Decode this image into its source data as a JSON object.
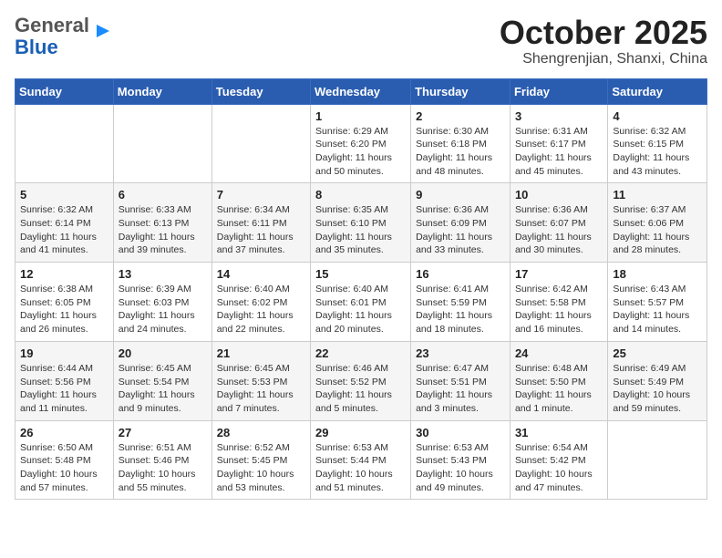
{
  "header": {
    "logo_general": "General",
    "logo_blue": "Blue",
    "month_title": "October 2025",
    "location": "Shengrenjian, Shanxi, China"
  },
  "weekdays": [
    "Sunday",
    "Monday",
    "Tuesday",
    "Wednesday",
    "Thursday",
    "Friday",
    "Saturday"
  ],
  "weeks": [
    [
      {
        "day": "",
        "info": ""
      },
      {
        "day": "",
        "info": ""
      },
      {
        "day": "",
        "info": ""
      },
      {
        "day": "1",
        "info": "Sunrise: 6:29 AM\nSunset: 6:20 PM\nDaylight: 11 hours\nand 50 minutes."
      },
      {
        "day": "2",
        "info": "Sunrise: 6:30 AM\nSunset: 6:18 PM\nDaylight: 11 hours\nand 48 minutes."
      },
      {
        "day": "3",
        "info": "Sunrise: 6:31 AM\nSunset: 6:17 PM\nDaylight: 11 hours\nand 45 minutes."
      },
      {
        "day": "4",
        "info": "Sunrise: 6:32 AM\nSunset: 6:15 PM\nDaylight: 11 hours\nand 43 minutes."
      }
    ],
    [
      {
        "day": "5",
        "info": "Sunrise: 6:32 AM\nSunset: 6:14 PM\nDaylight: 11 hours\nand 41 minutes."
      },
      {
        "day": "6",
        "info": "Sunrise: 6:33 AM\nSunset: 6:13 PM\nDaylight: 11 hours\nand 39 minutes."
      },
      {
        "day": "7",
        "info": "Sunrise: 6:34 AM\nSunset: 6:11 PM\nDaylight: 11 hours\nand 37 minutes."
      },
      {
        "day": "8",
        "info": "Sunrise: 6:35 AM\nSunset: 6:10 PM\nDaylight: 11 hours\nand 35 minutes."
      },
      {
        "day": "9",
        "info": "Sunrise: 6:36 AM\nSunset: 6:09 PM\nDaylight: 11 hours\nand 33 minutes."
      },
      {
        "day": "10",
        "info": "Sunrise: 6:36 AM\nSunset: 6:07 PM\nDaylight: 11 hours\nand 30 minutes."
      },
      {
        "day": "11",
        "info": "Sunrise: 6:37 AM\nSunset: 6:06 PM\nDaylight: 11 hours\nand 28 minutes."
      }
    ],
    [
      {
        "day": "12",
        "info": "Sunrise: 6:38 AM\nSunset: 6:05 PM\nDaylight: 11 hours\nand 26 minutes."
      },
      {
        "day": "13",
        "info": "Sunrise: 6:39 AM\nSunset: 6:03 PM\nDaylight: 11 hours\nand 24 minutes."
      },
      {
        "day": "14",
        "info": "Sunrise: 6:40 AM\nSunset: 6:02 PM\nDaylight: 11 hours\nand 22 minutes."
      },
      {
        "day": "15",
        "info": "Sunrise: 6:40 AM\nSunset: 6:01 PM\nDaylight: 11 hours\nand 20 minutes."
      },
      {
        "day": "16",
        "info": "Sunrise: 6:41 AM\nSunset: 5:59 PM\nDaylight: 11 hours\nand 18 minutes."
      },
      {
        "day": "17",
        "info": "Sunrise: 6:42 AM\nSunset: 5:58 PM\nDaylight: 11 hours\nand 16 minutes."
      },
      {
        "day": "18",
        "info": "Sunrise: 6:43 AM\nSunset: 5:57 PM\nDaylight: 11 hours\nand 14 minutes."
      }
    ],
    [
      {
        "day": "19",
        "info": "Sunrise: 6:44 AM\nSunset: 5:56 PM\nDaylight: 11 hours\nand 11 minutes."
      },
      {
        "day": "20",
        "info": "Sunrise: 6:45 AM\nSunset: 5:54 PM\nDaylight: 11 hours\nand 9 minutes."
      },
      {
        "day": "21",
        "info": "Sunrise: 6:45 AM\nSunset: 5:53 PM\nDaylight: 11 hours\nand 7 minutes."
      },
      {
        "day": "22",
        "info": "Sunrise: 6:46 AM\nSunset: 5:52 PM\nDaylight: 11 hours\nand 5 minutes."
      },
      {
        "day": "23",
        "info": "Sunrise: 6:47 AM\nSunset: 5:51 PM\nDaylight: 11 hours\nand 3 minutes."
      },
      {
        "day": "24",
        "info": "Sunrise: 6:48 AM\nSunset: 5:50 PM\nDaylight: 11 hours\nand 1 minute."
      },
      {
        "day": "25",
        "info": "Sunrise: 6:49 AM\nSunset: 5:49 PM\nDaylight: 10 hours\nand 59 minutes."
      }
    ],
    [
      {
        "day": "26",
        "info": "Sunrise: 6:50 AM\nSunset: 5:48 PM\nDaylight: 10 hours\nand 57 minutes."
      },
      {
        "day": "27",
        "info": "Sunrise: 6:51 AM\nSunset: 5:46 PM\nDaylight: 10 hours\nand 55 minutes."
      },
      {
        "day": "28",
        "info": "Sunrise: 6:52 AM\nSunset: 5:45 PM\nDaylight: 10 hours\nand 53 minutes."
      },
      {
        "day": "29",
        "info": "Sunrise: 6:53 AM\nSunset: 5:44 PM\nDaylight: 10 hours\nand 51 minutes."
      },
      {
        "day": "30",
        "info": "Sunrise: 6:53 AM\nSunset: 5:43 PM\nDaylight: 10 hours\nand 49 minutes."
      },
      {
        "day": "31",
        "info": "Sunrise: 6:54 AM\nSunset: 5:42 PM\nDaylight: 10 hours\nand 47 minutes."
      },
      {
        "day": "",
        "info": ""
      }
    ]
  ]
}
